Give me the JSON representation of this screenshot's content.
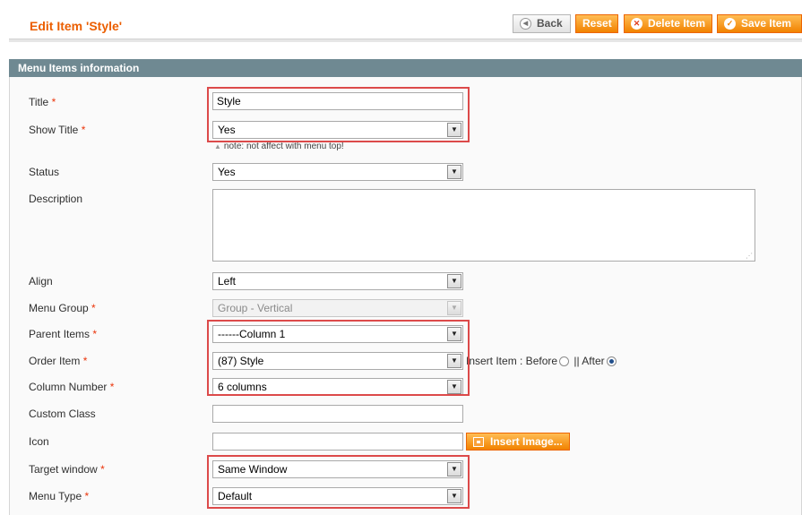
{
  "header": {
    "title": "Edit Item 'Style'",
    "buttons": {
      "back": "Back",
      "reset": "Reset",
      "delete": "Delete Item",
      "save": "Save Item"
    }
  },
  "section": {
    "title": "Menu Items information"
  },
  "fields": {
    "title": {
      "label": "Title",
      "required": "*",
      "value": "Style"
    },
    "show_title": {
      "label": "Show Title",
      "required": "*",
      "value": "Yes",
      "note": "note: not affect with menu top!"
    },
    "status": {
      "label": "Status",
      "value": "Yes"
    },
    "description": {
      "label": "Description",
      "value": ""
    },
    "align": {
      "label": "Align",
      "value": "Left"
    },
    "menu_group": {
      "label": "Menu Group",
      "required": "*",
      "value": "Group - Vertical",
      "disabled": true
    },
    "parent_items": {
      "label": "Parent Items",
      "required": "*",
      "value": "------Column 1"
    },
    "order_item": {
      "label": "Order Item",
      "required": "*",
      "value": "(87) Style",
      "insert_label": "Insert Item : Before",
      "after_label": "|| After",
      "selected_position": "After"
    },
    "column_number": {
      "label": "Column Number",
      "required": "*",
      "value": "6 columns"
    },
    "custom_class": {
      "label": "Custom Class",
      "value": ""
    },
    "icon": {
      "label": "Icon",
      "value": "",
      "button": "Insert Image..."
    },
    "target_window": {
      "label": "Target window",
      "required": "*",
      "value": "Same Window"
    },
    "menu_type": {
      "label": "Menu Type",
      "required": "*",
      "value": "Default"
    }
  },
  "colors": {
    "title_orange": "#eb5e00",
    "button_orange": "#f18200",
    "section_header": "#6f8992",
    "highlight_red": "#dc4a4a",
    "required_red": "#eb340a"
  }
}
